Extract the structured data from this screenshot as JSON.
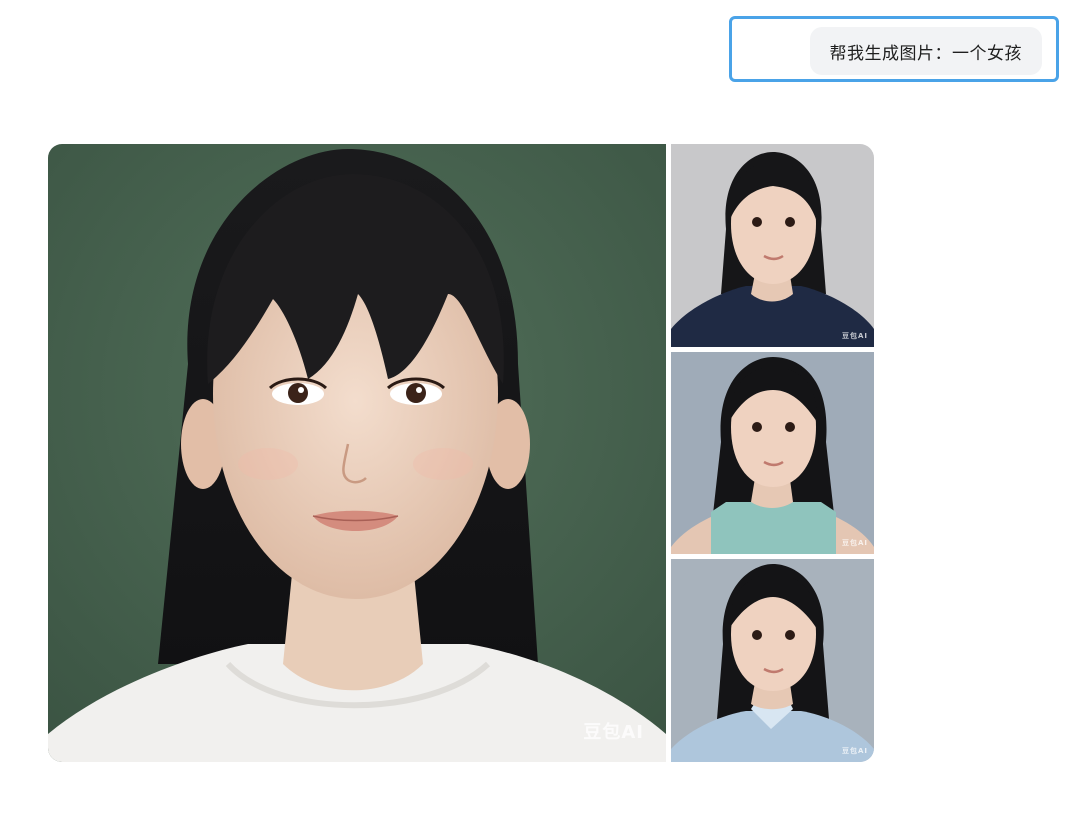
{
  "chat": {
    "user_message": "帮我生成图片：一个女孩"
  },
  "images": {
    "main": {
      "watermark": "豆包AI",
      "background": "#4a6550"
    },
    "thumbs": [
      {
        "watermark": "豆包AI",
        "background": "#c9c9cb",
        "top": "#1f2a44"
      },
      {
        "watermark": "豆包AI",
        "background": "#9eabb8",
        "top": "#8fc4bd"
      },
      {
        "watermark": "豆包AI",
        "background": "#a9b3bd",
        "top": "#aec6dc"
      }
    ]
  }
}
